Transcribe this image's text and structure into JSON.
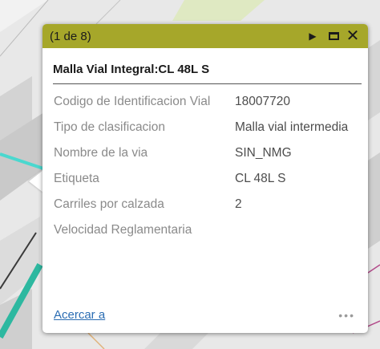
{
  "popup": {
    "counter": "(1 de 8)",
    "title": "Malla Vial Integral:CL 48L S",
    "attributes": [
      {
        "label": "Codigo de Identificacion Vial",
        "value": "18007720"
      },
      {
        "label": "Tipo de clasificacion",
        "value": "Malla vial intermedia"
      },
      {
        "label": "Nombre de la via",
        "value": "SIN_NMG"
      },
      {
        "label": "Etiqueta",
        "value": "CL 48L S"
      },
      {
        "label": "Carriles por calzada",
        "value": "2"
      },
      {
        "label": "Velocidad Reglamentaria",
        "value": ""
      }
    ],
    "zoom_link": "Acercar a",
    "more_label": "•••",
    "header_color": "#a6a72a",
    "link_color": "#2b6db3"
  },
  "icons": {
    "next": "next-arrow-icon",
    "maximize": "maximize-icon",
    "close": "close-icon",
    "more": "ellipsis-icon"
  }
}
